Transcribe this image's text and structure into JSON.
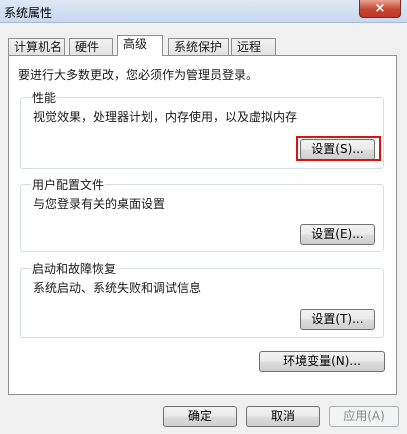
{
  "window": {
    "title": "系统属性",
    "close_icon": "close-icon",
    "close_glyph": "×"
  },
  "tabs": [
    "计算机名",
    "硬件",
    "高级",
    "系统保护",
    "远程"
  ],
  "active_tab": "高级",
  "note": "要进行大多数更改，您必须作为管理员登录。",
  "performance": {
    "legend": "性能",
    "desc": "视觉效果，处理器计划，内存使用，以及虚拟内存",
    "button": "设置(S)..."
  },
  "user_profiles": {
    "legend": "用户配置文件",
    "desc": "与您登录有关的桌面设置",
    "button": "设置(E)..."
  },
  "startup_recovery": {
    "legend": "启动和故障恢复",
    "desc": "系统启动、系统失败和调试信息",
    "button": "设置(T)..."
  },
  "env_button": "环境变量(N)...",
  "footer": {
    "ok": "确定",
    "cancel": "取消",
    "apply": "应用(A)"
  },
  "annotation": {
    "highlight_color": "#e01010"
  }
}
